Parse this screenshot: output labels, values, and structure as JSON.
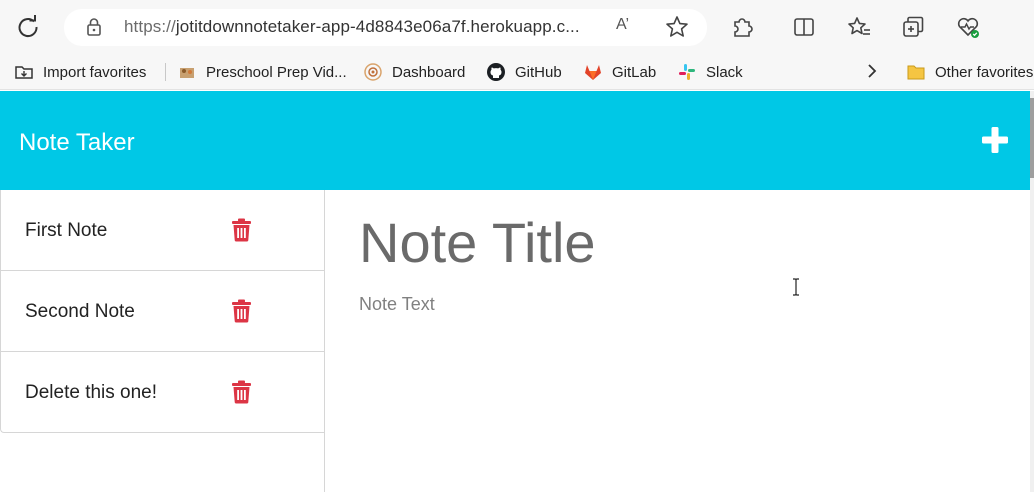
{
  "browser": {
    "url_protocol": "https://",
    "url_rest": "jotitdownnotetaker-app-4d8843e06a7f.herokuapp.c...",
    "read_aloud_label": "A’",
    "favorites": [
      {
        "label": "Import favorites",
        "icon": "import-icon"
      },
      {
        "label": "Preschool Prep Vid...",
        "icon": "preschool-icon"
      },
      {
        "label": "Dashboard",
        "icon": "dashboard-icon"
      },
      {
        "label": "GitHub",
        "icon": "github-icon"
      },
      {
        "label": "GitLab",
        "icon": "gitlab-icon"
      },
      {
        "label": "Slack",
        "icon": "slack-icon"
      }
    ],
    "other_favorites": "Other favorites"
  },
  "app": {
    "title": "Note Taker",
    "accent_color": "#00c8e6",
    "delete_color": "#dc3545"
  },
  "notes": [
    {
      "title": "First Note"
    },
    {
      "title": "Second Note"
    },
    {
      "title": "Delete this one!"
    }
  ],
  "editor": {
    "title_placeholder": "Note Title",
    "text_placeholder": "Note Text"
  }
}
